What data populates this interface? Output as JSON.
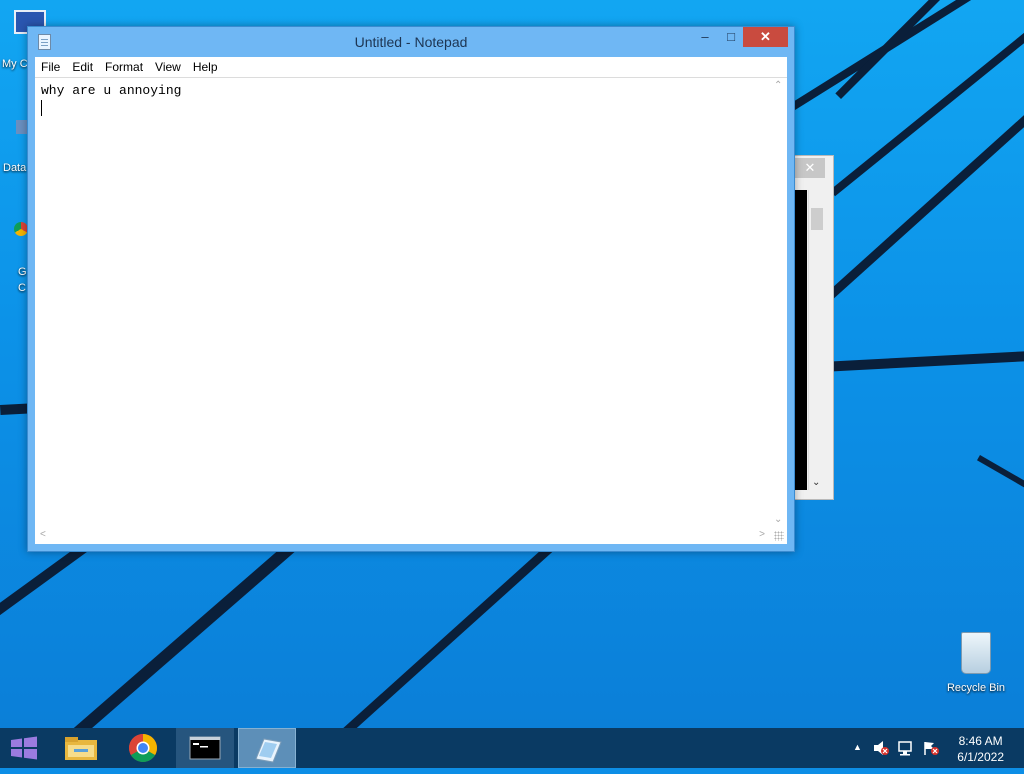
{
  "desktop": {
    "icons": [
      {
        "label": "My C"
      },
      {
        "label": "Data"
      },
      {
        "label": "G"
      },
      {
        "label": "C"
      },
      {
        "label": "Recycle Bin"
      }
    ]
  },
  "notepad": {
    "title": "Untitled - Notepad",
    "controls": {
      "minimize": "–",
      "maximize": "□",
      "close": "✕"
    },
    "menu": [
      "File",
      "Edit",
      "Format",
      "View",
      "Help"
    ],
    "content": "why are u annoying"
  },
  "background_window": {
    "close": "✕"
  },
  "taskbar": {
    "items": [
      {
        "name": "file-explorer"
      },
      {
        "name": "chrome"
      },
      {
        "name": "command-prompt"
      },
      {
        "name": "notepad"
      }
    ],
    "tray": {
      "time": "8:46 AM",
      "date": "6/1/2022"
    }
  },
  "colors": {
    "desktop": "#0c92e8",
    "taskbar": "#0a3a63",
    "close": "#c94b3f"
  }
}
